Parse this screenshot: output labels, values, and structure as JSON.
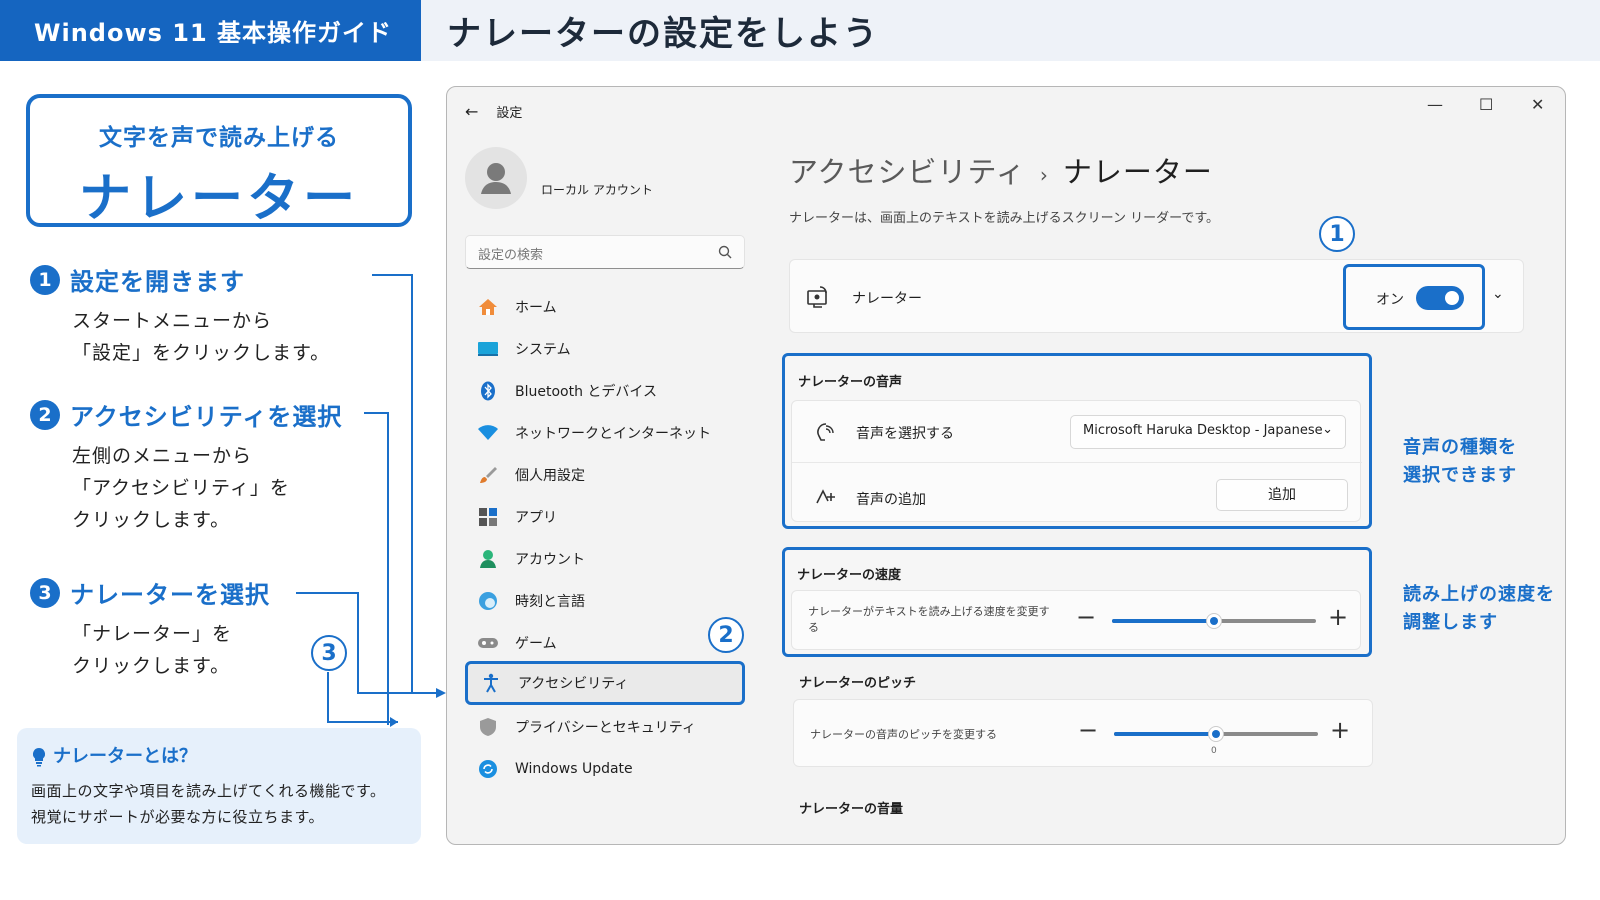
{
  "header": {
    "guide_title": "Windows 11 基本操作ガイド",
    "page_title": "ナレーターの設定をしよう"
  },
  "title_box": {
    "subtitle": "文字を声で読み上げる",
    "title": "ナレーター"
  },
  "steps": [
    {
      "num": "1",
      "title": "設定を開きます",
      "desc": [
        "スタートメニューから",
        "「設定」をクリックします。"
      ]
    },
    {
      "num": "2",
      "title": "アクセシビリティを選択",
      "desc": [
        "左側のメニューから",
        "「アクセシビリティ」を",
        "クリックします。"
      ]
    },
    {
      "num": "3",
      "title": "ナレーターを選択",
      "desc": [
        "「ナレーター」を",
        "クリックします。"
      ]
    }
  ],
  "callouts": {
    "c1": "1",
    "c2": "2",
    "c3": "3"
  },
  "info": {
    "title": "ナレーターとは？",
    "lines": [
      "画面上の文字や項目を読み上げてくれる機能です。",
      "視覚にサポートが必要な方に役立ちます。"
    ]
  },
  "window": {
    "titlebar": "設定",
    "account": "ローカル アカウント",
    "search_placeholder": "設定の検索",
    "nav": [
      {
        "label": "ホーム",
        "icon": "home-icon"
      },
      {
        "label": "システム",
        "icon": "system-icon"
      },
      {
        "label": "Bluetooth とデバイス",
        "icon": "bluetooth-icon"
      },
      {
        "label": "ネットワークとインターネット",
        "icon": "wifi-icon"
      },
      {
        "label": "個人用設定",
        "icon": "brush-icon"
      },
      {
        "label": "アプリ",
        "icon": "apps-icon"
      },
      {
        "label": "アカウント",
        "icon": "account-icon"
      },
      {
        "label": "時刻と言語",
        "icon": "globe-icon"
      },
      {
        "label": "ゲーム",
        "icon": "gamepad-icon"
      },
      {
        "label": "アクセシビリティ",
        "icon": "accessibility-icon",
        "selected": true
      },
      {
        "label": "プライバシーとセキュリティ",
        "icon": "shield-icon"
      },
      {
        "label": "Windows Update",
        "icon": "update-icon"
      }
    ],
    "breadcrumb": {
      "parent": "アクセシビリティ",
      "sep": "›",
      "current": "ナレーター"
    },
    "description": "ナレーターは、画面上のテキストを読み上げるスクリーン リーダーです。",
    "narrator_row": {
      "label": "ナレーター",
      "toggle_label": "オン",
      "toggle_on": true
    },
    "voice_section": {
      "title": "ナレーターの音声",
      "select_label": "音声を選択する",
      "select_value": "Microsoft Haruka Desktop - Japanese",
      "add_label": "音声の追加",
      "add_button": "追加"
    },
    "speed_section": {
      "title": "ナレーターの速度",
      "row_label_1": "ナレーターがテキストを読み上げる速度を変更す",
      "row_label_2": "る",
      "value_fraction": 0.5
    },
    "pitch_section": {
      "title": "ナレーターのピッチ",
      "row_label": "ナレーターの音声のピッチを変更する",
      "value_label": "0",
      "value_fraction": 0.5
    },
    "volume_section": {
      "title": "ナレーターの音量"
    }
  },
  "notes": {
    "voice": [
      "音声の種類を",
      "選択できます"
    ],
    "speed": [
      "読み上げの速度を",
      "調整します"
    ]
  },
  "colors": {
    "accent": "#1a6fc9",
    "header_bg": "#1565c0"
  }
}
